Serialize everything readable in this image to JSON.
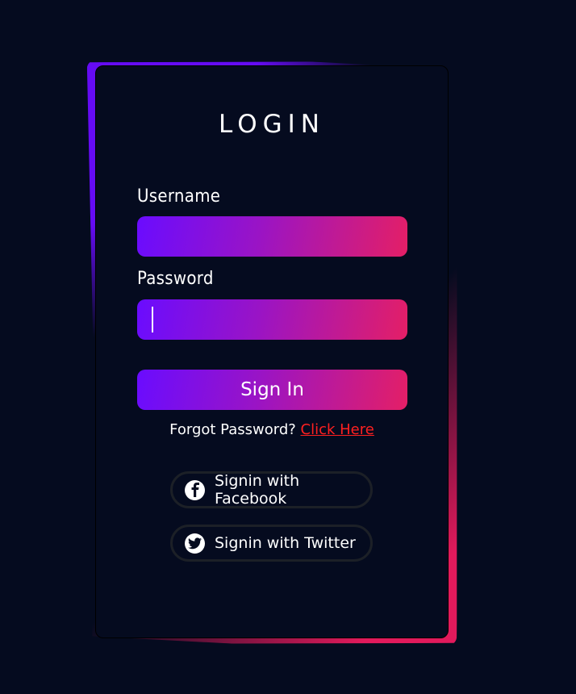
{
  "login": {
    "title": "LOGIN",
    "username_label": "Username",
    "password_label": "Password",
    "username_value": "",
    "password_value": "",
    "signin_label": "Sign In",
    "forgot_text": "Forgot Password?",
    "click_here": "Click Here",
    "facebook_label": "Signin with Facebook",
    "twitter_label": "Signin with Twitter"
  },
  "icons": {
    "facebook": "facebook-icon",
    "twitter": "twitter-icon"
  },
  "colors": {
    "background": "#050b1f",
    "gradient_start": "#6a0cff",
    "gradient_end": "#e41f66",
    "link": "#ff2020"
  }
}
